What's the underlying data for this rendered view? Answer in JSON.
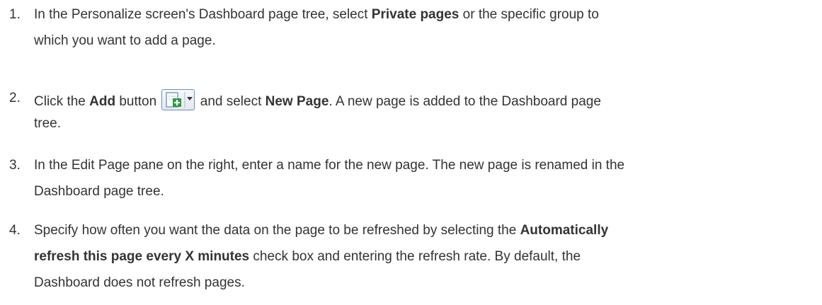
{
  "steps": [
    {
      "number": "1.",
      "line1": {
        "pre": "In the Personalize screen's Dashboard page tree, select ",
        "bold": "Private pages",
        "post": " or the specific group to"
      },
      "line2": "which you want to add a page."
    },
    {
      "number": "2.",
      "line1": {
        "pre": "Click the ",
        "bold1": "Add",
        "mid": " button ",
        "post": " and select ",
        "bold2": "New Page",
        "tail": ". A new page is added to the Dashboard page"
      },
      "line2": "tree.",
      "icon": "add-page-dropdown-icon"
    },
    {
      "number": "3.",
      "line1": "In the Edit Page pane on the right, enter a name for the new page. The new page is renamed in the",
      "line2": "Dashboard page tree."
    },
    {
      "number": "4.",
      "line1": {
        "pre": "Specify how often you want the data on the page to be refreshed by selecting the ",
        "bold": "Automatically"
      },
      "line2": {
        "bold": "refresh this page every X minutes",
        "post": " check box and entering the refresh rate. By default, the"
      },
      "line3": "Dashboard does not refresh pages."
    }
  ]
}
